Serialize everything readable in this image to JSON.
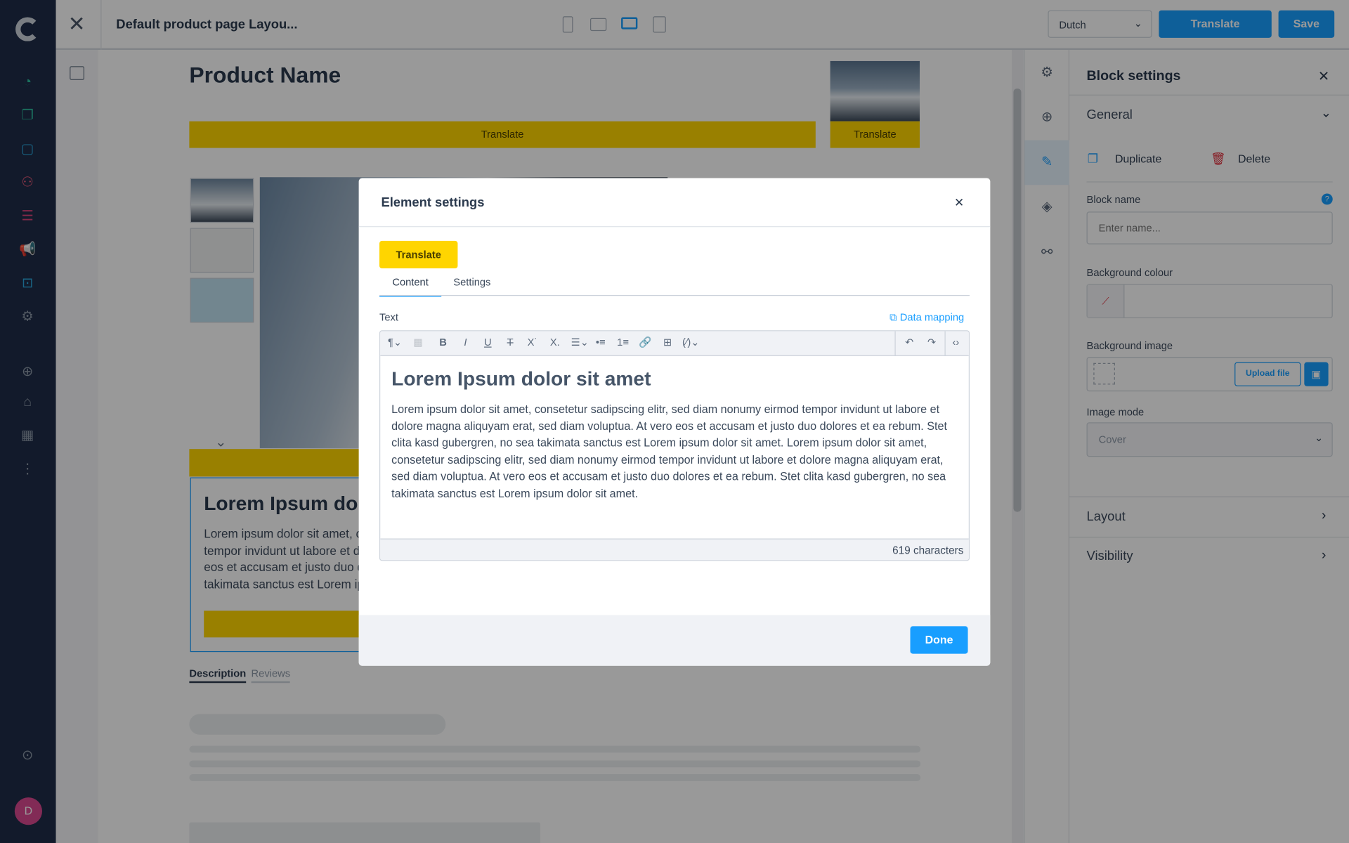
{
  "topbar": {
    "title": "Default product page Layou...",
    "language": "Dutch",
    "translate_label": "Translate",
    "save_label": "Save"
  },
  "canvas": {
    "product_name": "Product Name",
    "translate_label": "Translate",
    "box_title": "Lorem Ipsum dolor sit amet",
    "box_text": "Lorem ipsum dolor sit amet, consetetur sadipscing elitr, sed diam nonumy eirmod tempor invidunt ut labore et dolore magna aliquyam erat, sed diam voluptua. At vero eos et accusam et justo duo dolores et ea rebum. Stet clita kasd gubergren, no sea takimata sanctus est Lorem ipsum dolor sit amet.",
    "tabs": [
      "Description",
      "Reviews"
    ]
  },
  "panel": {
    "title": "Block settings",
    "general": "General",
    "duplicate": "Duplicate",
    "delete": "Delete",
    "block_name_label": "Block name",
    "block_name_placeholder": "Enter name...",
    "bg_colour_label": "Background colour",
    "bg_image_label": "Background image",
    "upload_label": "Upload file",
    "image_mode_label": "Image mode",
    "image_mode_value": "Cover",
    "layout": "Layout",
    "visibility": "Visibility"
  },
  "modal": {
    "title": "Element settings",
    "translate_label": "Translate",
    "tabs": [
      "Content",
      "Settings"
    ],
    "text_label": "Text",
    "data_mapping": "Data mapping",
    "heading": "Lorem Ipsum dolor sit amet",
    "body": "Lorem ipsum dolor sit amet, consetetur sadipscing elitr, sed diam nonumy eirmod tempor invidunt ut labore et dolore magna aliquyam erat, sed diam voluptua. At vero eos et accusam et justo duo dolores et ea rebum. Stet clita kasd gubergren, no sea takimata sanctus est Lorem ipsum dolor sit amet. Lorem ipsum dolor sit amet, consetetur sadipscing elitr, sed diam nonumy eirmod tempor invidunt ut labore et dolore magna aliquyam erat, sed diam voluptua. At vero eos et accusam et justo duo dolores et ea rebum. Stet clita kasd gubergren, no sea takimata sanctus est Lorem ipsum dolor sit amet.",
    "char_count": "619 characters",
    "done_label": "Done"
  },
  "user": {
    "avatar_initial": "D"
  },
  "colors": {
    "accent": "#189eff",
    "yellow": "#ffd500",
    "nav": "#1e2c49",
    "avatar": "#d9488f"
  }
}
